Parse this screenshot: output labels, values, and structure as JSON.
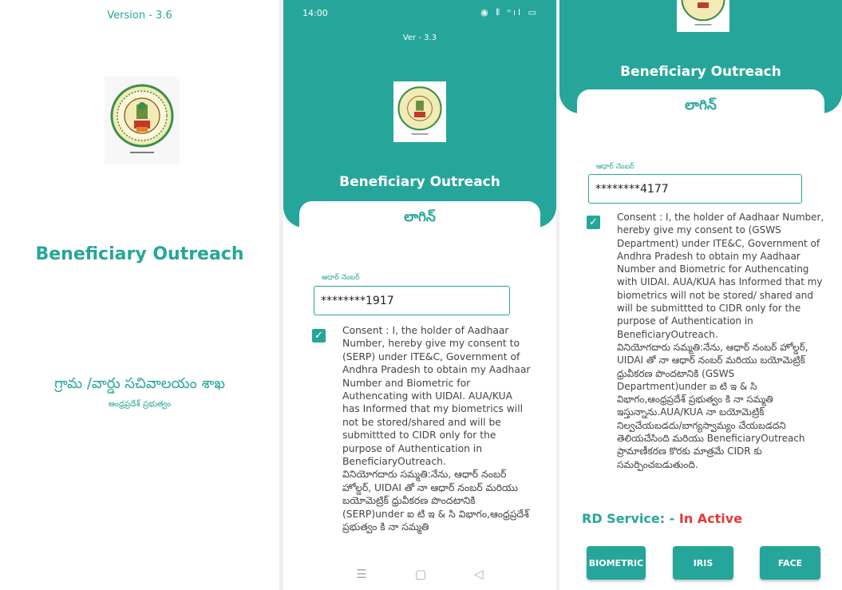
{
  "colors": {
    "accent": "#26a69a",
    "status_inactive": "#e53935"
  },
  "splash": {
    "version": "Version - 3.6",
    "app_title": "Beneficiary Outreach",
    "department": "గ్రామ /వార్డు సచివాలయం శాఖ",
    "state": "ఆంధ్రప్రదేశ్ ప్రభుత్వం"
  },
  "login_a": {
    "status_time": "14:00",
    "status_icons": "◉ ⦀ ⁿıl ▭",
    "version": "Ver - 3.3",
    "app_title": "Beneficiary Outreach",
    "login_title": "లాగిన్",
    "aadhaar_label": "ఆధార్ నెంబర్",
    "aadhaar_value": "********1917",
    "consent_en": "Consent : I, the holder of Aadhaar Number, hereby give my consent to (SERP) under ITE&C, Government of Andhra Pradesh to obtain my Aadhaar Number and Biometric for Authencating with UIDAI. AUA/KUA has Informed that my biometrics will not be stored/shared and will be submittted to CIDR only for the purpose of Authentication in BeneficiaryOutreach.",
    "consent_te": "వినియోగదారు సమ్మతి:నేను, ఆధార్ నంబర్ హోల్డర్, UIDAI తో నా ఆధార్ నంబర్ మరియు బయోమెట్రిక్ ధ్రువీకరణ పొందటానికి (SERP)under ఐ టి ఇ & సి విభాగం,ఆంధ్రప్రదేశ్ ప్రభుత్వం కి నా సమ్మతి",
    "nav_menu": "☰",
    "nav_home": "▢",
    "nav_back": "◁"
  },
  "login_b": {
    "app_title": "Beneficiary Outreach",
    "login_title": "లాగిన్",
    "aadhaar_label": "ఆధార్ నెంబర్",
    "aadhaar_value": "********4177",
    "consent_en": "Consent : I, the holder of Aadhaar Number, hereby give my consent to (GSWS Department) under ITE&C, Government of Andhra Pradesh to obtain my Aadhaar Number and Biometric for Authencating with UIDAI. AUA/KUA has Informed that my biometrics will not be stored/ shared and will be submittted to CIDR only for the purpose of Authentication in BeneficiaryOutreach.",
    "consent_te": "వినియోగదారు సమ్మతి:నేను, ఆధార్ నంబర్ హోల్డర్, UIDAI తో నా ఆధార్ నంబర్ మరియు బయోమెట్రిక్ ధ్రువీకరణ పొందటానికి (GSWS Department)under ఐ టి ఇ & సి విభాగం,ఆంధ్రప్రదేశ్ ప్రభుత్వం కి నా సమ్మతి ఇస్తున్నాను.AUA/KUA నా బయోమెట్రిక్ నిల్వచేయబడదు/బాగ్యస్వామ్యం చేయబడదని తెలియచేసింది మరియు BeneficiaryOutreach ప్రామాణీకరణ కొరకు మాత్రమే CIDR కు సమర్పించబడుతుంది.",
    "rd_label": "RD Service: -",
    "rd_status": "In Active",
    "buttons": {
      "biometric": "BIOMETRIC",
      "iris": "IRIS",
      "face": "FACE"
    }
  }
}
